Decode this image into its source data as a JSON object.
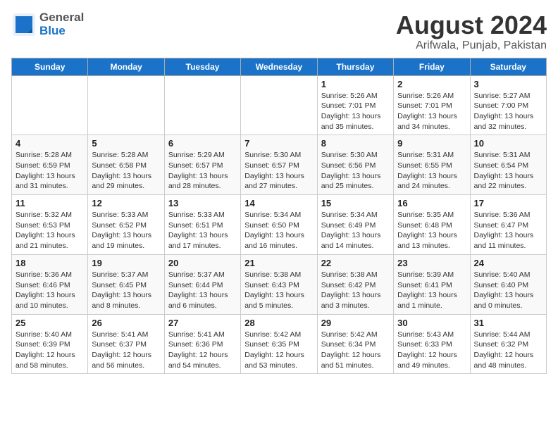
{
  "header": {
    "logo_general": "General",
    "logo_blue": "Blue",
    "title": "August 2024",
    "subtitle": "Arifwala, Punjab, Pakistan"
  },
  "calendar": {
    "days_of_week": [
      "Sunday",
      "Monday",
      "Tuesday",
      "Wednesday",
      "Thursday",
      "Friday",
      "Saturday"
    ],
    "weeks": [
      [
        {
          "day": "",
          "info": ""
        },
        {
          "day": "",
          "info": ""
        },
        {
          "day": "",
          "info": ""
        },
        {
          "day": "",
          "info": ""
        },
        {
          "day": "1",
          "info": "Sunrise: 5:26 AM\nSunset: 7:01 PM\nDaylight: 13 hours\nand 35 minutes."
        },
        {
          "day": "2",
          "info": "Sunrise: 5:26 AM\nSunset: 7:01 PM\nDaylight: 13 hours\nand 34 minutes."
        },
        {
          "day": "3",
          "info": "Sunrise: 5:27 AM\nSunset: 7:00 PM\nDaylight: 13 hours\nand 32 minutes."
        }
      ],
      [
        {
          "day": "4",
          "info": "Sunrise: 5:28 AM\nSunset: 6:59 PM\nDaylight: 13 hours\nand 31 minutes."
        },
        {
          "day": "5",
          "info": "Sunrise: 5:28 AM\nSunset: 6:58 PM\nDaylight: 13 hours\nand 29 minutes."
        },
        {
          "day": "6",
          "info": "Sunrise: 5:29 AM\nSunset: 6:57 PM\nDaylight: 13 hours\nand 28 minutes."
        },
        {
          "day": "7",
          "info": "Sunrise: 5:30 AM\nSunset: 6:57 PM\nDaylight: 13 hours\nand 27 minutes."
        },
        {
          "day": "8",
          "info": "Sunrise: 5:30 AM\nSunset: 6:56 PM\nDaylight: 13 hours\nand 25 minutes."
        },
        {
          "day": "9",
          "info": "Sunrise: 5:31 AM\nSunset: 6:55 PM\nDaylight: 13 hours\nand 24 minutes."
        },
        {
          "day": "10",
          "info": "Sunrise: 5:31 AM\nSunset: 6:54 PM\nDaylight: 13 hours\nand 22 minutes."
        }
      ],
      [
        {
          "day": "11",
          "info": "Sunrise: 5:32 AM\nSunset: 6:53 PM\nDaylight: 13 hours\nand 21 minutes."
        },
        {
          "day": "12",
          "info": "Sunrise: 5:33 AM\nSunset: 6:52 PM\nDaylight: 13 hours\nand 19 minutes."
        },
        {
          "day": "13",
          "info": "Sunrise: 5:33 AM\nSunset: 6:51 PM\nDaylight: 13 hours\nand 17 minutes."
        },
        {
          "day": "14",
          "info": "Sunrise: 5:34 AM\nSunset: 6:50 PM\nDaylight: 13 hours\nand 16 minutes."
        },
        {
          "day": "15",
          "info": "Sunrise: 5:34 AM\nSunset: 6:49 PM\nDaylight: 13 hours\nand 14 minutes."
        },
        {
          "day": "16",
          "info": "Sunrise: 5:35 AM\nSunset: 6:48 PM\nDaylight: 13 hours\nand 13 minutes."
        },
        {
          "day": "17",
          "info": "Sunrise: 5:36 AM\nSunset: 6:47 PM\nDaylight: 13 hours\nand 11 minutes."
        }
      ],
      [
        {
          "day": "18",
          "info": "Sunrise: 5:36 AM\nSunset: 6:46 PM\nDaylight: 13 hours\nand 10 minutes."
        },
        {
          "day": "19",
          "info": "Sunrise: 5:37 AM\nSunset: 6:45 PM\nDaylight: 13 hours\nand 8 minutes."
        },
        {
          "day": "20",
          "info": "Sunrise: 5:37 AM\nSunset: 6:44 PM\nDaylight: 13 hours\nand 6 minutes."
        },
        {
          "day": "21",
          "info": "Sunrise: 5:38 AM\nSunset: 6:43 PM\nDaylight: 13 hours\nand 5 minutes."
        },
        {
          "day": "22",
          "info": "Sunrise: 5:38 AM\nSunset: 6:42 PM\nDaylight: 13 hours\nand 3 minutes."
        },
        {
          "day": "23",
          "info": "Sunrise: 5:39 AM\nSunset: 6:41 PM\nDaylight: 13 hours\nand 1 minute."
        },
        {
          "day": "24",
          "info": "Sunrise: 5:40 AM\nSunset: 6:40 PM\nDaylight: 13 hours\nand 0 minutes."
        }
      ],
      [
        {
          "day": "25",
          "info": "Sunrise: 5:40 AM\nSunset: 6:39 PM\nDaylight: 12 hours\nand 58 minutes."
        },
        {
          "day": "26",
          "info": "Sunrise: 5:41 AM\nSunset: 6:37 PM\nDaylight: 12 hours\nand 56 minutes."
        },
        {
          "day": "27",
          "info": "Sunrise: 5:41 AM\nSunset: 6:36 PM\nDaylight: 12 hours\nand 54 minutes."
        },
        {
          "day": "28",
          "info": "Sunrise: 5:42 AM\nSunset: 6:35 PM\nDaylight: 12 hours\nand 53 minutes."
        },
        {
          "day": "29",
          "info": "Sunrise: 5:42 AM\nSunset: 6:34 PM\nDaylight: 12 hours\nand 51 minutes."
        },
        {
          "day": "30",
          "info": "Sunrise: 5:43 AM\nSunset: 6:33 PM\nDaylight: 12 hours\nand 49 minutes."
        },
        {
          "day": "31",
          "info": "Sunrise: 5:44 AM\nSunset: 6:32 PM\nDaylight: 12 hours\nand 48 minutes."
        }
      ]
    ]
  }
}
